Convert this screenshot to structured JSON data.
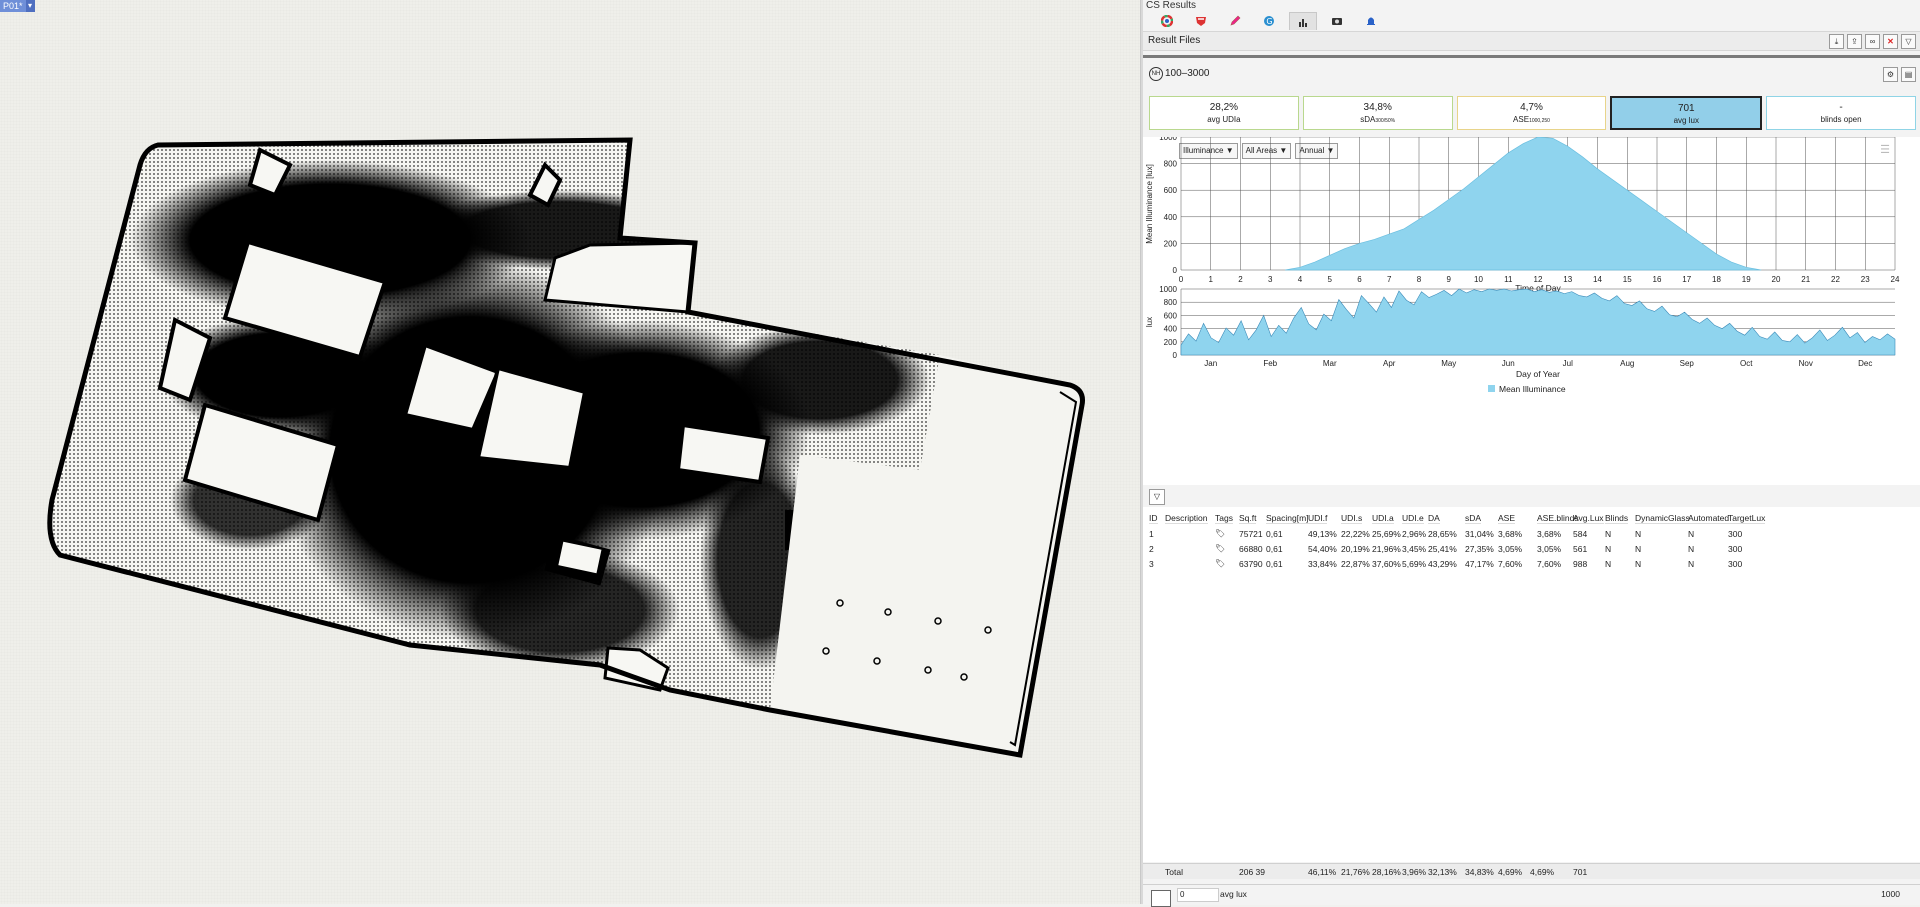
{
  "viewport": {
    "name": "P01*",
    "dropdown": "▾"
  },
  "panel": {
    "title": "CS Results",
    "tabs": [
      "color-wheel-icon",
      "shield-icon",
      "pencil-icon",
      "globe-icon",
      "bar-chart-icon",
      "camera-icon",
      "bell-icon"
    ],
    "result_files_label": "Result Files",
    "file_name": "100–3000",
    "file_icon_text": "NH",
    "buttons": {
      "download": "⤓",
      "export": "⇪",
      "link": "∞",
      "close": "✕",
      "filter": "▽",
      "settings": "⚙",
      "doc": "▤"
    },
    "metrics": [
      {
        "value": "28,2%",
        "label": "avg UDIa",
        "sub": "",
        "color": "#b9d88e",
        "bg": "#ffffff"
      },
      {
        "value": "34,8%",
        "label": "sDA",
        "sub": "300/50%",
        "color": "#b9d88e",
        "bg": "#ffffff"
      },
      {
        "value": "4,7%",
        "label": "ASE",
        "sub": "1000,250",
        "color": "#e8d48a",
        "bg": "#ffffff"
      },
      {
        "value": "701",
        "label": "avg lux",
        "sub": "",
        "color": "#222222",
        "bg": "#92cfe9"
      },
      {
        "value": "-",
        "label": "blinds open",
        "sub": "",
        "color": "#8fd4e6",
        "bg": "#ffffff"
      }
    ],
    "selectors": [
      "Illuminance ▼",
      "All Areas ▼",
      "Annual ▼"
    ],
    "filter_icon": "▽",
    "table": {
      "headers": [
        "ID",
        "Description",
        "Tags",
        "Sq.ft",
        "Spacing[m]",
        "UDI.f",
        "UDI.s",
        "UDI.a",
        "UDI.e",
        "DA",
        "sDA",
        "ASE",
        "ASE.blinds",
        "Avg.Lux",
        "Blinds",
        "DynamicGlass",
        "Automated",
        "TargetLux"
      ],
      "rows": [
        [
          "1",
          "",
          "",
          "75721",
          "0,61",
          "49,13%",
          "22,22%",
          "25,69%",
          "2,96%",
          "28,65%",
          "31,04%",
          "3,68%",
          "3,68%",
          "584",
          "N",
          "N",
          "N",
          "300"
        ],
        [
          "2",
          "",
          "",
          "66880",
          "0,61",
          "54,40%",
          "20,19%",
          "21,96%",
          "3,45%",
          "25,41%",
          "27,35%",
          "3,05%",
          "3,05%",
          "561",
          "N",
          "N",
          "N",
          "300"
        ],
        [
          "3",
          "",
          "",
          "63790",
          "0,61",
          "33,84%",
          "22,87%",
          "37,60%",
          "5,69%",
          "43,29%",
          "47,17%",
          "7,60%",
          "7,60%",
          "988",
          "N",
          "N",
          "N",
          "300"
        ]
      ],
      "total": {
        "label": "Total",
        "sqft": "206 39",
        "udif": "46,11%",
        "udis": "21,76%",
        "udia": "28,16%",
        "udie": "3,96%",
        "da": "32,13%",
        "sda": "34,83%",
        "ase": "4,69%",
        "aseb": "4,69%",
        "avg": "701"
      }
    },
    "legend": {
      "min": "0",
      "unit": "avg lux",
      "max": "1000"
    }
  },
  "chart_data": [
    {
      "type": "area",
      "title": "",
      "xlabel": "Time of Day",
      "ylabel": "Mean Illuminance [lux]",
      "xlim": [
        0,
        24
      ],
      "ylim": [
        0,
        1000
      ],
      "x_ticks": [
        "0",
        "1",
        "2",
        "3",
        "4",
        "5",
        "6",
        "7",
        "8",
        "9",
        "10",
        "11",
        "12",
        "13",
        "14",
        "15",
        "16",
        "17",
        "18",
        "19",
        "20",
        "21",
        "22",
        "23",
        "24"
      ],
      "y_ticks": [
        "0",
        "200",
        "400",
        "600",
        "800",
        "1000"
      ],
      "grid": true,
      "color": "#8fd4ee",
      "x": [
        3.5,
        4,
        4.5,
        5,
        5.5,
        6,
        6.5,
        7,
        7.5,
        8,
        8.5,
        9,
        9.5,
        10,
        10.5,
        11,
        11.5,
        12,
        12.5,
        13,
        13.5,
        14,
        14.5,
        15,
        15.5,
        16,
        16.5,
        17,
        17.5,
        18,
        18.5,
        19,
        19.5
      ],
      "series": [
        {
          "values": [
            0,
            20,
            60,
            110,
            160,
            200,
            230,
            270,
            310,
            380,
            450,
            530,
            610,
            700,
            790,
            880,
            950,
            1000,
            990,
            930,
            850,
            760,
            680,
            600,
            520,
            440,
            360,
            280,
            200,
            120,
            60,
            20,
            0
          ]
        }
      ]
    },
    {
      "type": "area",
      "title": "",
      "xlabel": "Day of Year",
      "ylabel": "lux",
      "ylim": [
        0,
        1000
      ],
      "y_ticks": [
        "0",
        "200",
        "400",
        "600",
        "800",
        "1000"
      ],
      "x_ticks": [
        "Jan",
        "Feb",
        "Mar",
        "Apr",
        "May",
        "Jun",
        "Jul",
        "Aug",
        "Sep",
        "Oct",
        "Nov",
        "Dec"
      ],
      "grid": true,
      "color": "#8fd4ee",
      "legend": [
        "Mean Illuminance"
      ],
      "series": [
        {
          "name": "Mean Illuminance",
          "values": [
            150,
            320,
            210,
            480,
            260,
            190,
            410,
            300,
            520,
            230,
            380,
            600,
            280,
            450,
            330,
            560,
            720,
            470,
            380,
            620,
            520,
            840,
            690,
            560,
            900,
            780,
            650,
            880,
            720,
            970,
            830,
            760,
            960,
            870,
            920,
            980,
            900,
            1000,
            940,
            990,
            960,
            1000,
            980,
            1000,
            970,
            990,
            1000,
            960,
            990,
            950,
            970,
            930,
            960,
            900,
            880,
            940,
            860,
            820,
            900,
            780,
            750,
            820,
            700,
            660,
            740,
            610,
            580,
            650,
            540,
            480,
            560,
            450,
            400,
            480,
            360,
            300,
            420,
            280,
            240,
            350,
            220,
            200,
            310,
            180,
            260,
            380,
            220,
            300,
            420,
            260,
            340,
            190,
            280,
            230,
            320,
            240
          ]
        }
      ]
    }
  ]
}
